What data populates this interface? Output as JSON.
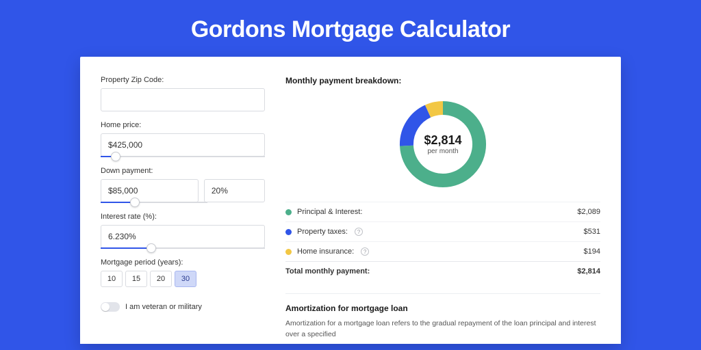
{
  "page_title": "Gordons Mortgage Calculator",
  "form": {
    "zip_label": "Property Zip Code:",
    "zip_value": "",
    "home_price_label": "Home price:",
    "home_price_value": "$425,000",
    "down_payment_label": "Down payment:",
    "down_payment_value": "$85,000",
    "down_payment_pct": "20%",
    "interest_label": "Interest rate (%):",
    "interest_value": "6.230%",
    "period_label": "Mortgage period (years):",
    "periods": [
      "10",
      "15",
      "20",
      "30"
    ],
    "period_active_index": 3,
    "veteran_label": "I am veteran or military"
  },
  "breakdown": {
    "title": "Monthly payment breakdown:",
    "center_amount": "$2,814",
    "center_sub": "per month",
    "rows": [
      {
        "label": "Principal & Interest:",
        "amount": "$2,089",
        "help": false
      },
      {
        "label": "Property taxes:",
        "amount": "$531",
        "help": true
      },
      {
        "label": "Home insurance:",
        "amount": "$194",
        "help": true
      }
    ],
    "total_label": "Total monthly payment:",
    "total_amount": "$2,814"
  },
  "amort": {
    "title": "Amortization for mortgage loan",
    "body": "Amortization for a mortgage loan refers to the gradual repayment of the loan principal and interest over a specified"
  },
  "chart_data": {
    "type": "pie",
    "title": "Monthly payment breakdown",
    "series": [
      {
        "name": "Principal & Interest",
        "value": 2089,
        "color": "#4caf8b"
      },
      {
        "name": "Property taxes",
        "value": 531,
        "color": "#3055e8"
      },
      {
        "name": "Home insurance",
        "value": 194,
        "color": "#f2c744"
      }
    ],
    "total": 2814,
    "center_label": "$2,814 per month"
  }
}
